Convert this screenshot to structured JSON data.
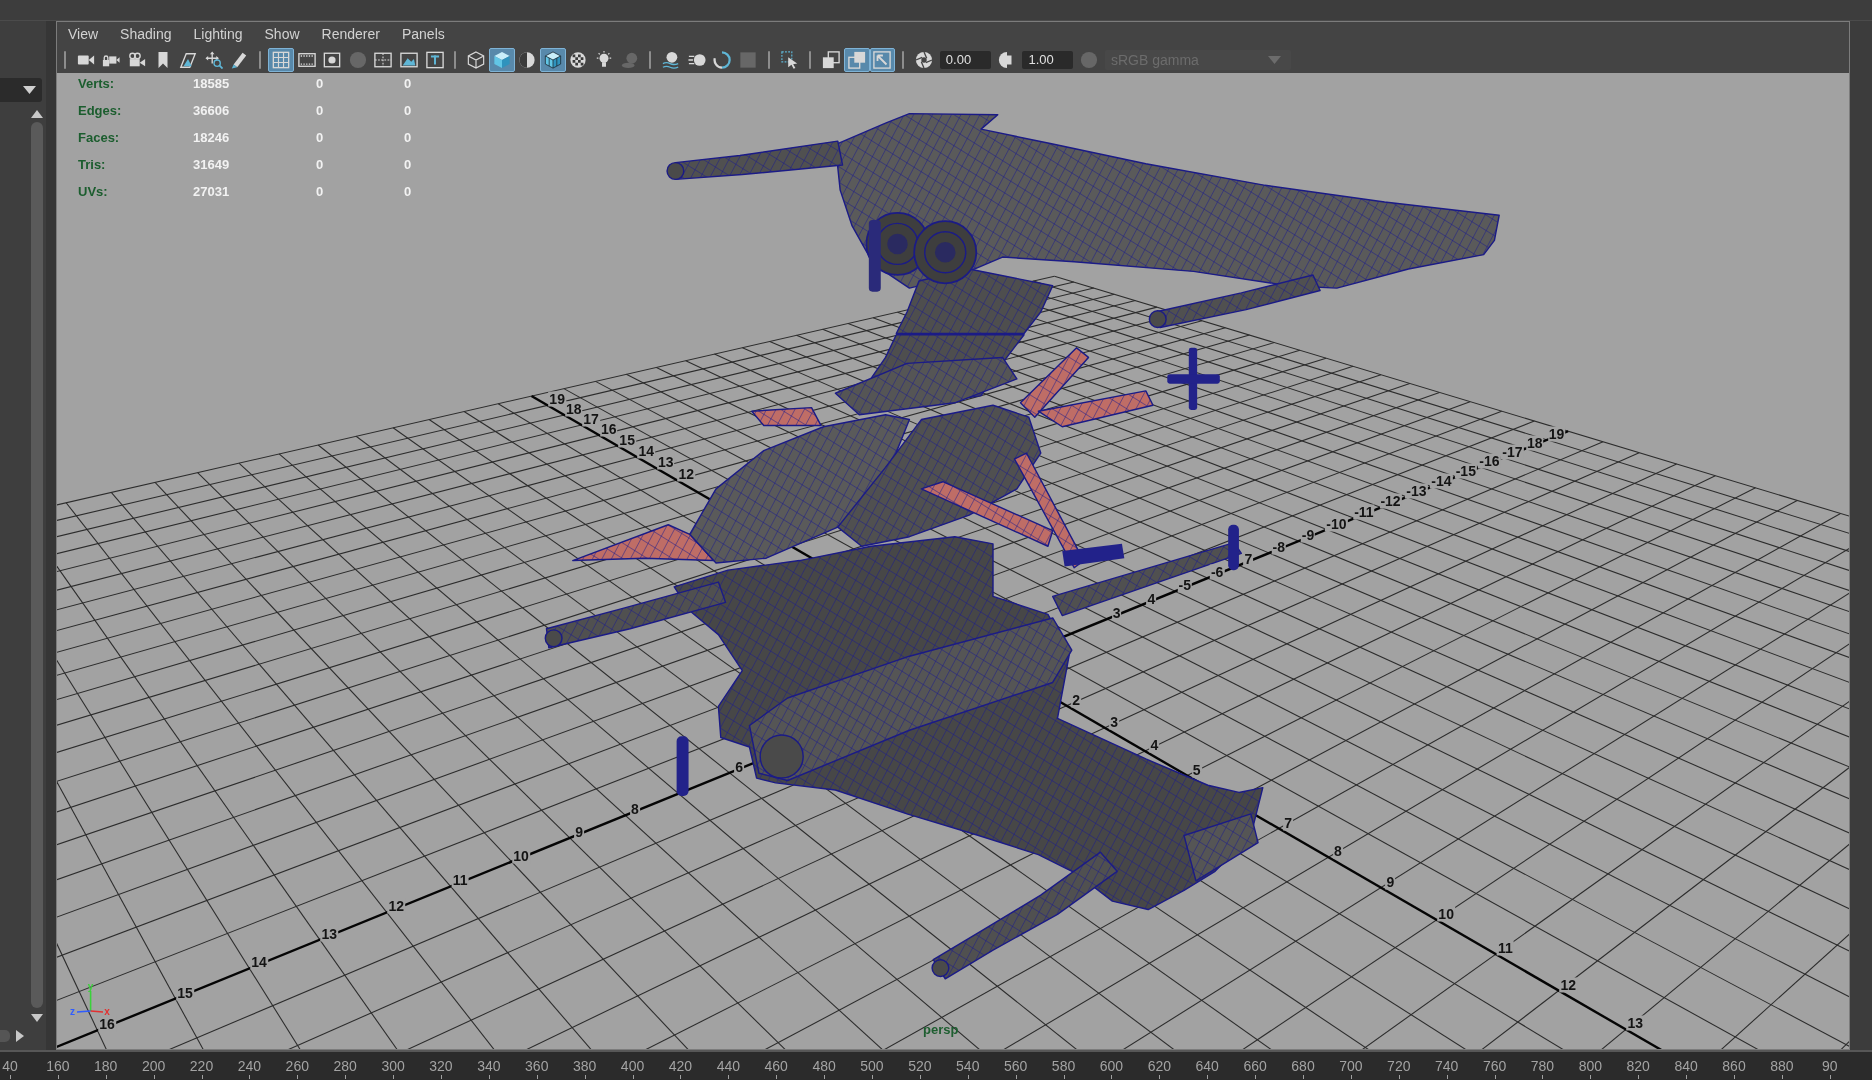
{
  "menu_bar": {
    "items": [
      "View",
      "Shading",
      "Lighting",
      "Show",
      "Renderer",
      "Panels"
    ]
  },
  "toolbar": {
    "groups": [
      [
        {
          "selected": false,
          "disabled": false
        },
        {
          "selected": false,
          "disabled": false
        },
        {
          "selected": false,
          "disabled": false
        },
        {
          "selected": false,
          "disabled": false
        },
        {
          "selected": false,
          "disabled": false
        },
        {
          "selected": false,
          "disabled": false
        },
        {
          "selected": false,
          "disabled": false
        }
      ],
      [
        {
          "selected": true,
          "disabled": false
        },
        {
          "selected": false,
          "disabled": false
        },
        {
          "selected": false,
          "disabled": false
        },
        {
          "selected": false,
          "disabled": true
        },
        {
          "selected": false,
          "disabled": false
        },
        {
          "selected": false,
          "disabled": false
        },
        {
          "selected": false,
          "disabled": false
        }
      ],
      [
        {
          "selected": false,
          "disabled": false
        },
        {
          "selected": true,
          "disabled": false
        },
        {
          "selected": false,
          "disabled": false
        },
        {
          "selected": true,
          "disabled": false
        },
        {
          "selected": false,
          "disabled": false
        },
        {
          "selected": false,
          "disabled": false
        },
        {
          "selected": false,
          "disabled": true
        }
      ],
      [
        {
          "selected": false,
          "disabled": false
        },
        {
          "selected": false,
          "disabled": false
        },
        {
          "selected": false,
          "disabled": false
        },
        {
          "selected": false,
          "disabled": true
        }
      ],
      [
        {
          "selected": false,
          "disabled": false
        }
      ],
      [
        {
          "selected": false,
          "disabled": false
        },
        {
          "selected": true,
          "disabled": false
        },
        {
          "selected": true,
          "disabled": false
        }
      ],
      [
        {
          "kind": "button",
          "selected": false,
          "disabled": false
        },
        {
          "kind": "field",
          "value": "0.00"
        },
        {
          "kind": "button",
          "selected": false,
          "disabled": false
        },
        {
          "kind": "field",
          "value": "1.00"
        },
        {
          "kind": "button",
          "selected": false,
          "disabled": true
        },
        {
          "kind": "dropdown",
          "value": "sRGB gamma",
          "disabled": true
        }
      ]
    ]
  },
  "hud": {
    "rows": [
      {
        "label": "Verts:",
        "values": [
          "18585",
          "0",
          "0"
        ]
      },
      {
        "label": "Edges:",
        "values": [
          "36606",
          "0",
          "0"
        ]
      },
      {
        "label": "Faces:",
        "values": [
          "18246",
          "0",
          "0"
        ]
      },
      {
        "label": "Tris:",
        "values": [
          "31649",
          "0",
          "0"
        ]
      },
      {
        "label": "UVs:",
        "values": [
          "27031",
          "0",
          "0"
        ]
      }
    ]
  },
  "grid_labels": {
    "axis_a_back": [
      "19",
      "18",
      "17",
      "16",
      "15",
      "14",
      "13",
      "12"
    ],
    "axis_a_front": [
      "2",
      "3",
      "4",
      "5",
      "7",
      "8",
      "9",
      "10",
      "11",
      "12",
      "13"
    ],
    "axis_b_front": [
      "16",
      "15",
      "14",
      "13",
      "12",
      "11",
      "10",
      "9",
      "8",
      "6"
    ],
    "axis_b_back": [
      "3",
      "4",
      "-5",
      "-6",
      "7",
      "-8",
      "-9",
      "-10",
      "-11",
      "-12",
      "-13",
      "-14",
      "-15",
      "-16",
      "-17",
      "18",
      "19"
    ]
  },
  "camera_name": "persp",
  "axis_indicator": {
    "axes": [
      {
        "label": "y",
        "color": "#3ad23a"
      },
      {
        "label": "z",
        "color": "#2f5cff"
      },
      {
        "label": "x",
        "color": "#e23030"
      }
    ]
  },
  "time_slider": {
    "labels": [
      "40",
      "160",
      "180",
      "200",
      "220",
      "240",
      "260",
      "280",
      "300",
      "320",
      "340",
      "360",
      "380",
      "400",
      "420",
      "440",
      "460",
      "480",
      "500",
      "520",
      "540",
      "560",
      "580",
      "600",
      "620",
      "640",
      "660",
      "680",
      "700",
      "720",
      "740",
      "760",
      "780",
      "800",
      "820",
      "840",
      "860",
      "880",
      "90"
    ]
  }
}
